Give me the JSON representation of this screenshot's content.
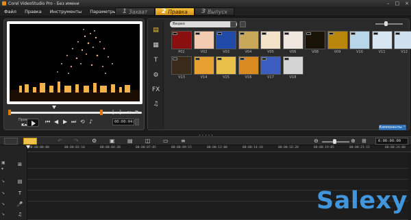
{
  "window": {
    "title": "Corel VideoStudio Pro - Без имени"
  },
  "menu": {
    "items": [
      "Файл",
      "Правка",
      "Инструменты",
      "Параметры"
    ]
  },
  "steps": [
    {
      "num": "1",
      "label": "Захват",
      "active": false
    },
    {
      "num": "2",
      "label": "Правка",
      "active": true
    },
    {
      "num": "3",
      "label": "Выпуск",
      "active": false
    }
  ],
  "preview": {
    "mode_project": "Проект",
    "mode_clip": "Клип",
    "timecode": "00:00:04:11"
  },
  "library": {
    "dropdown_value": "Видео",
    "components_label": "Компоненты",
    "thumbs_row1": [
      "P02",
      "V02",
      "V03",
      "V04",
      "V05",
      "V06",
      "V08",
      "V09",
      "V10",
      "V11",
      "V12"
    ],
    "thumbs_row2": [
      "V13",
      "V14",
      "V15",
      "V16",
      "V17",
      "V18"
    ],
    "thumb_colors_row1": [
      "#8a1010",
      "#f2cbb0",
      "#1f4aa8",
      "#c9a85a",
      "#f4e3c8",
      "#f0e8de",
      "#1a1408",
      "#b8860b",
      "#b7d6ea",
      "#d8e6f2",
      "#cfe0ef"
    ],
    "thumb_colors_row2": [
      "#3a2a1a",
      "#e8a030",
      "#e8c04a",
      "#d98a20",
      "#3b5ec0",
      "#d4d4d4"
    ]
  },
  "timeline": {
    "timecode": "0:00:00:00",
    "ruler": [
      "00:00:00:00",
      "00:00:02:10",
      "00:00:04:20",
      "00:00:07:05",
      "00:00:09:15",
      "00:00:12:00",
      "00:00:14:10",
      "00:00:16:20",
      "00:00:19:05",
      "00:00:21:15",
      "00:00:24:00"
    ]
  },
  "colors": {
    "accent": "#f0c24a",
    "trim_marker": "#e07a10",
    "components_blue": "#2f6fb5"
  },
  "watermark": "Salexy"
}
